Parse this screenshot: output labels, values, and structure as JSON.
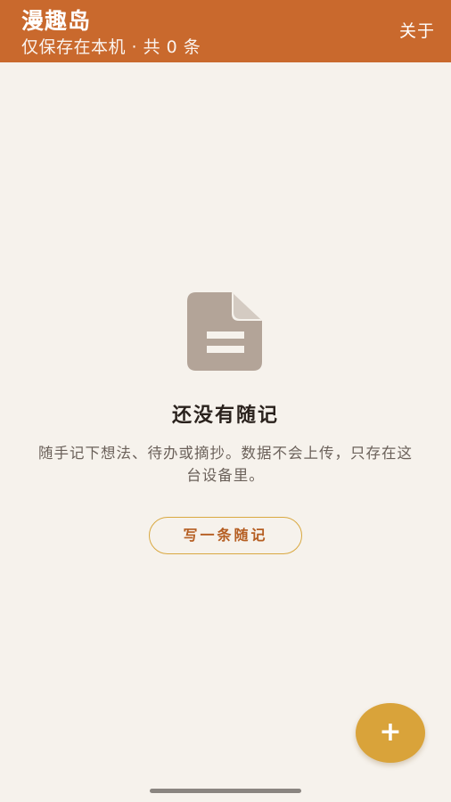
{
  "appbar": {
    "title": "漫趣岛",
    "subtitle": "仅保存在本机 · 共 0 条",
    "about_label": "关于"
  },
  "empty_state": {
    "icon": "document-icon",
    "title": "还没有随记",
    "description": "随手记下想法、待办或摘抄。数据不会上传，只存在这台设备里。",
    "button_label": "写一条随记"
  },
  "fab": {
    "label": "+",
    "icon": "plus-icon"
  },
  "colors": {
    "appbar": "#C9692D",
    "background": "#F6F2EC",
    "accent": "#D9A33A",
    "icon": "#B3A498"
  }
}
